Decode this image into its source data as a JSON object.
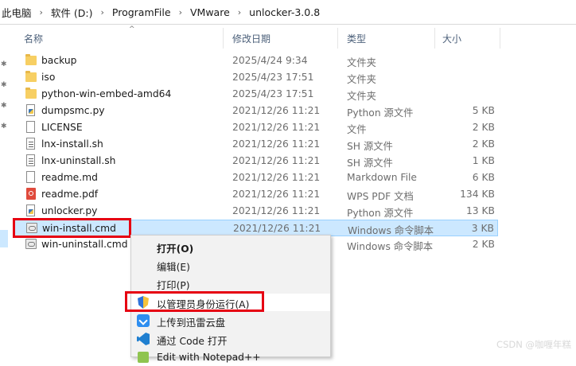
{
  "breadcrumb": [
    "此电脑",
    "软件 (D:)",
    "ProgramFile",
    "VMware",
    "unlocker-3.0.8"
  ],
  "columns": {
    "name": "名称",
    "modified": "修改日期",
    "type": "类型",
    "size": "大小"
  },
  "files": [
    {
      "name": "backup",
      "modified": "2025/4/24 9:34",
      "type": "文件夹",
      "size": "",
      "icon": "folder-icon"
    },
    {
      "name": "iso",
      "modified": "2025/4/23 17:51",
      "type": "文件夹",
      "size": "",
      "icon": "folder-icon"
    },
    {
      "name": "python-win-embed-amd64",
      "modified": "2025/4/23 17:51",
      "type": "文件夹",
      "size": "",
      "icon": "folder-icon"
    },
    {
      "name": "dumpsmc.py",
      "modified": "2021/12/26 11:21",
      "type": "Python 源文件",
      "size": "5 KB",
      "icon": "python-file-icon"
    },
    {
      "name": "LICENSE",
      "modified": "2021/12/26 11:21",
      "type": "文件",
      "size": "2 KB",
      "icon": "file-icon"
    },
    {
      "name": "lnx-install.sh",
      "modified": "2021/12/26 11:21",
      "type": "SH 源文件",
      "size": "2 KB",
      "icon": "sh-file-icon"
    },
    {
      "name": "lnx-uninstall.sh",
      "modified": "2021/12/26 11:21",
      "type": "SH 源文件",
      "size": "1 KB",
      "icon": "sh-file-icon"
    },
    {
      "name": "readme.md",
      "modified": "2021/12/26 11:21",
      "type": "Markdown File",
      "size": "6 KB",
      "icon": "markdown-file-icon"
    },
    {
      "name": "readme.pdf",
      "modified": "2021/12/26 11:21",
      "type": "WPS PDF 文档",
      "size": "134 KB",
      "icon": "pdf-file-icon"
    },
    {
      "name": "unlocker.py",
      "modified": "2021/12/26 11:21",
      "type": "Python 源文件",
      "size": "13 KB",
      "icon": "python-file-icon"
    },
    {
      "name": "win-install.cmd",
      "modified": "2021/12/26 11:21",
      "type": "Windows 命令脚本",
      "size": "3 KB",
      "icon": "cmd-file-icon",
      "selected": true
    },
    {
      "name": "win-uninstall.cmd",
      "modified": "2021/12/26 11:21",
      "type": "Windows 命令脚本",
      "size": "2 KB",
      "icon": "cmd-file-icon"
    }
  ],
  "context_menu": [
    {
      "label": "打开(O)",
      "bold": true,
      "icon": ""
    },
    {
      "label": "编辑(E)",
      "icon": ""
    },
    {
      "label": "打印(P)",
      "icon": ""
    },
    {
      "label": "以管理员身份运行(A)",
      "icon": "uac-shield-icon",
      "hover": true
    },
    {
      "label": "上传到迅雷云盘",
      "icon": "xunlei-icon"
    },
    {
      "label": "通过 Code 打开",
      "icon": "vscode-icon"
    },
    {
      "label": "Edit with Notepad++",
      "icon": "notepadpp-icon"
    }
  ],
  "colors": {
    "selection": "#cce8ff",
    "highlight_box": "#e60012",
    "menu_bg": "#f2f2f2"
  },
  "watermark": "CSDN @咖喱年糕"
}
